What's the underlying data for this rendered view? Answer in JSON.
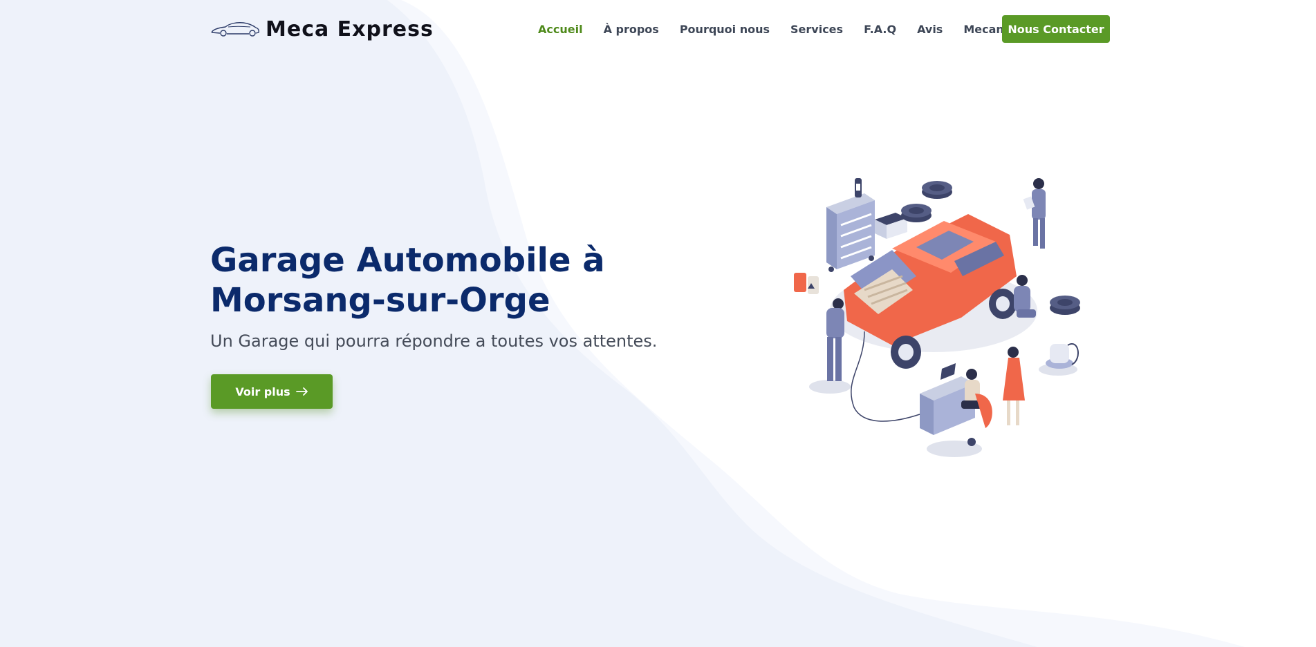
{
  "header": {
    "logo_text": "Meca Express",
    "logo_icon": "car-outline-icon",
    "nav": [
      {
        "label": "Accueil",
        "active": true
      },
      {
        "label": "À propos",
        "active": false
      },
      {
        "label": "Pourquoi nous",
        "active": false
      },
      {
        "label": "Services",
        "active": false
      },
      {
        "label": "F.A.Q",
        "active": false
      },
      {
        "label": "Avis",
        "active": false
      },
      {
        "label": "Mecanique",
        "active": false,
        "dropdown": true
      }
    ],
    "cta_label": "Nous Contacter"
  },
  "hero": {
    "title_line1": "Garage Automobile à",
    "title_line2": "Morsang-sur-Orge",
    "subtitle": "Un Garage qui pourra répondre a toutes vos attentes.",
    "button_label": "Voir plus",
    "button_icon": "arrow-right-icon",
    "illustration": "garage-mechanics-illustration"
  },
  "colors": {
    "accent_green": "#5a9a26",
    "active_nav_green": "#4f8a1b",
    "title_navy": "#0b2a6b",
    "background_wave": "#eef2fa",
    "car_orange": "#f0674a"
  }
}
